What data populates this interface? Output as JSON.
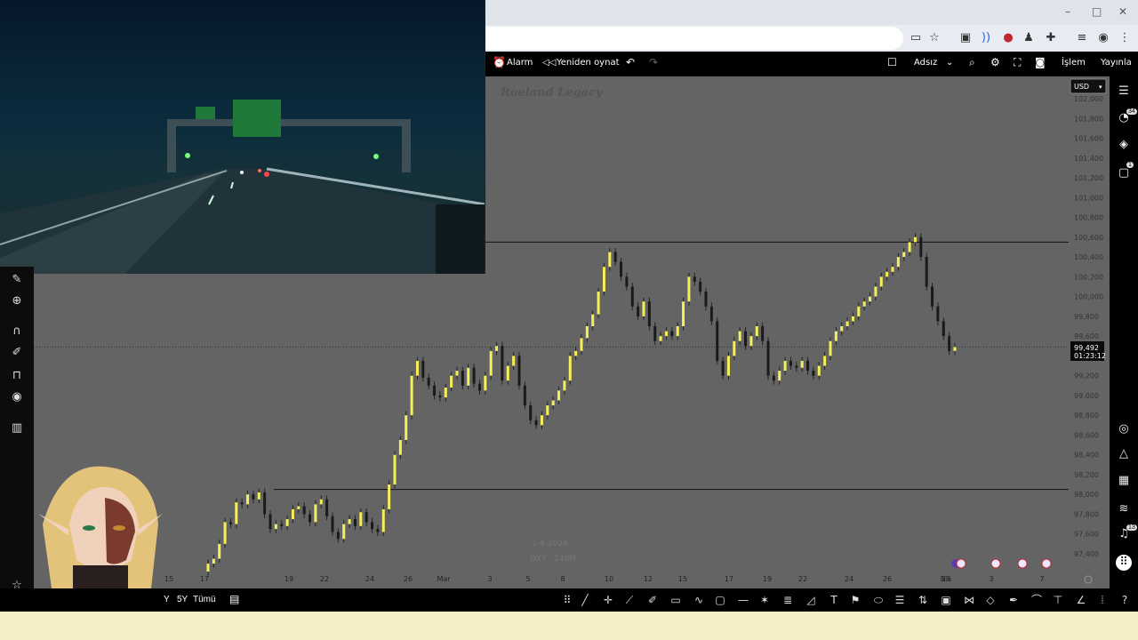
{
  "browser": {
    "window_controls": [
      "–",
      "□",
      "✕"
    ],
    "toolbar_icons": [
      "clipboard-icon",
      "star-icon",
      "cast-icon",
      "wave-icon",
      "avatar-badge-icon",
      "user-icon",
      "extension-icon",
      "list-icon",
      "profile-icon",
      "menu-icon"
    ]
  },
  "tv_header": {
    "alarm_label": "Alarm",
    "replay_label": "Yeniden oynat",
    "layout_name": "Adsız",
    "trade_label": "İşlem",
    "publish_label": "Yayınla"
  },
  "chart": {
    "watermark": "Roeland Legacy",
    "currency_select": "USD",
    "last_price": "99,492",
    "countdown": "01:23:12",
    "date_stamp": "1-4-2026",
    "symbol_stamp": "DXY · 240M",
    "price_ticks": [
      "102,000",
      "101,800",
      "101,600",
      "101,400",
      "101,200",
      "101,000",
      "100,800",
      "100,600",
      "100,400",
      "100,200",
      "100,000",
      "99,800",
      "99,600",
      "99,400",
      "99,200",
      "99,000",
      "98,800",
      "98,600",
      "98,400",
      "98,200",
      "98,000",
      "97,800",
      "97,600",
      "97,400"
    ],
    "time_ticks": [
      "15",
      "17",
      "19",
      "22",
      "24",
      "26",
      "Mar",
      "3",
      "5",
      "8",
      "10",
      "12",
      "15",
      "17",
      "19",
      "22",
      "24",
      "26",
      "29",
      "Nis",
      "3",
      "7"
    ]
  },
  "chart_data": {
    "type": "candlestick",
    "title": "Roeland Legacy",
    "xlabel": "",
    "ylabel": "",
    "ylim": [
      97.3,
      102.1
    ],
    "horizontal_lines": [
      100.55,
      98.05
    ],
    "current_price_line": 99.49,
    "x_labels": [
      "15",
      "17",
      "19",
      "22",
      "24",
      "26",
      "Mar",
      "3",
      "5",
      "8",
      "10",
      "12",
      "15",
      "17",
      "19",
      "22",
      "24",
      "26",
      "29",
      "Nis",
      "3",
      "7"
    ],
    "closes": [
      97.3,
      97.35,
      97.5,
      97.72,
      97.7,
      97.92,
      97.9,
      98.0,
      97.95,
      98.02,
      97.8,
      97.65,
      97.7,
      97.68,
      97.75,
      97.85,
      97.88,
      97.8,
      97.72,
      97.9,
      97.95,
      97.78,
      97.62,
      97.55,
      97.7,
      97.75,
      97.68,
      97.82,
      97.72,
      97.65,
      97.62,
      97.85,
      98.1,
      98.4,
      98.55,
      98.8,
      99.2,
      99.35,
      99.18,
      99.1,
      99.0,
      98.98,
      99.08,
      99.2,
      99.25,
      99.1,
      99.28,
      99.12,
      99.05,
      99.2,
      99.45,
      99.5,
      99.15,
      99.3,
      99.4,
      99.1,
      98.9,
      98.75,
      98.7,
      98.8,
      98.9,
      98.95,
      99.05,
      99.15,
      99.4,
      99.45,
      99.58,
      99.7,
      99.82,
      100.05,
      100.3,
      100.45,
      100.35,
      100.2,
      100.1,
      99.9,
      99.8,
      99.95,
      99.7,
      99.55,
      99.6,
      99.65,
      99.6,
      99.7,
      99.95,
      100.2,
      100.15,
      100.05,
      99.9,
      99.75,
      99.35,
      99.2,
      99.4,
      99.55,
      99.65,
      99.5,
      99.6,
      99.7,
      99.55,
      99.2,
      99.15,
      99.25,
      99.35,
      99.3,
      99.28,
      99.35,
      99.25,
      99.2,
      99.3,
      99.4,
      99.55,
      99.65,
      99.7,
      99.75,
      99.8,
      99.9,
      99.95,
      100.0,
      100.1,
      100.2,
      100.25,
      100.3,
      100.4,
      100.45,
      100.55,
      100.6,
      100.4,
      100.1,
      99.9,
      99.75,
      99.6,
      99.45,
      99.49
    ]
  },
  "bottom_bar": {
    "range_5y": "5Y",
    "range_all": "Tümü"
  },
  "right_badges": {
    "alerts": "34",
    "chat": "1",
    "notifications": "13"
  }
}
